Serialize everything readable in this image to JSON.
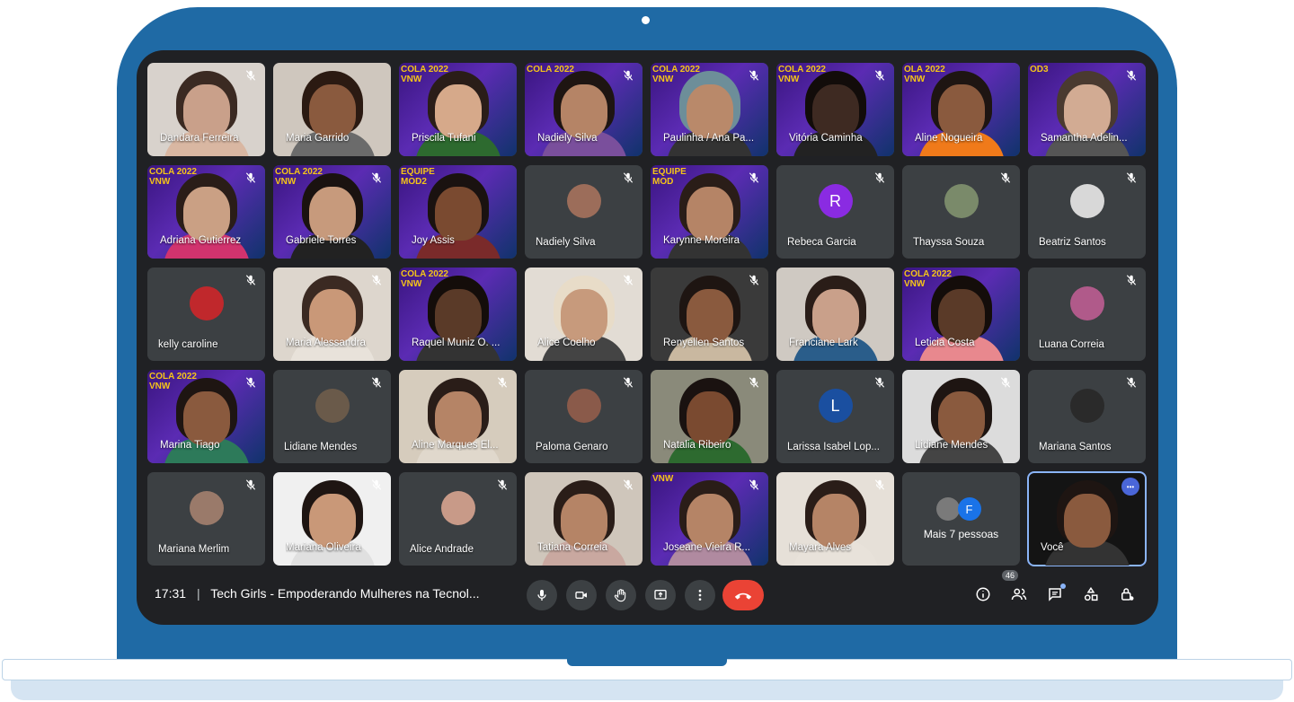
{
  "colors": {
    "laptop": "#1f6aa5",
    "screen_bg": "#202124",
    "tile_bg": "#3c4043",
    "hangup": "#ea4335",
    "self_outline": "#8ab4f8"
  },
  "tiles": [
    {
      "name": "Dandara Ferreira",
      "kind": "video",
      "muted": true,
      "skin": "#c9a08a",
      "hair": "#3b2a22",
      "shirt": "#d9b7a2",
      "bg": "#d8d2cc"
    },
    {
      "name": "Maria Garrido",
      "kind": "video",
      "muted": false,
      "skin": "#8a5a3e",
      "hair": "#2b1a12",
      "shirt": "#6b6b6b",
      "bg": "#cfc7be"
    },
    {
      "name": "Priscila Tufani",
      "kind": "video",
      "muted": false,
      "banner": true,
      "banner_text": "COLA 2022\nVNW",
      "skin": "#d6a98a",
      "hair": "#2a1d18",
      "shirt": "#2d6a2f",
      "bg": ""
    },
    {
      "name": "Nadiely Silva",
      "kind": "video",
      "muted": true,
      "banner": true,
      "banner_text": "COLA 2022",
      "skin": "#b58466",
      "hair": "#1e1512",
      "shirt": "#7a4f9c",
      "bg": ""
    },
    {
      "name": "Paulinha / Ana Pa...",
      "kind": "video",
      "muted": true,
      "banner": true,
      "banner_text": "COLA 2022\nVNW",
      "skin": "#b9896a",
      "hair": "#6d8e99",
      "shirt": "#333333",
      "bg": ""
    },
    {
      "name": "Vitória Caminha",
      "kind": "video",
      "muted": true,
      "banner": true,
      "banner_text": "COLA 2022\nVNW",
      "skin": "#3e2a22",
      "hair": "#120c0a",
      "shirt": "#222222",
      "bg": ""
    },
    {
      "name": "Aline Nogueira",
      "kind": "video",
      "muted": false,
      "banner": true,
      "banner_text": "OLA 2022\nVNW",
      "skin": "#8a5a3e",
      "hair": "#1e1512",
      "shirt": "#f07a1a",
      "bg": ""
    },
    {
      "name": "Samantha Adelin...",
      "kind": "video",
      "muted": true,
      "banner": true,
      "banner_text": "OD3",
      "skin": "#d2ab93",
      "hair": "#4a3a30",
      "shirt": "#555555",
      "bg": ""
    },
    {
      "name": "Adriana Gutierrez",
      "kind": "video",
      "muted": true,
      "banner": true,
      "banner_text": "COLA 2022\nVNW",
      "skin": "#caa084",
      "hair": "#2a1d18",
      "shirt": "#d1336e",
      "bg": ""
    },
    {
      "name": "Gabriele Torres",
      "kind": "video",
      "muted": true,
      "banner": true,
      "banner_text": "COLA 2022\nVNW",
      "skin": "#c79a7c",
      "hair": "#1a1210",
      "shirt": "#222222",
      "bg": ""
    },
    {
      "name": "Joy Assis",
      "kind": "video",
      "muted": false,
      "banner": true,
      "banner_text": "EQUIPE\nMOD2",
      "skin": "#7a4a30",
      "hair": "#1a1210",
      "shirt": "#7a2a2a",
      "bg": ""
    },
    {
      "name": "Nadiely Silva",
      "kind": "avatar",
      "muted": true,
      "avatar_color": "#9c6d5a"
    },
    {
      "name": "Karynne Moreira",
      "kind": "video",
      "muted": true,
      "banner": true,
      "banner_text": "EQUIPE\nMOD",
      "skin": "#b58466",
      "hair": "#2a1d18",
      "shirt": "#333333",
      "bg": ""
    },
    {
      "name": "Rebeca Garcia",
      "kind": "letter",
      "muted": true,
      "letter": "R",
      "avatar_color": "#8a2be2"
    },
    {
      "name": "Thayssa Souza",
      "kind": "avatar",
      "muted": true,
      "avatar_color": "#7a8a6a"
    },
    {
      "name": "Beatriz Santos",
      "kind": "avatar",
      "muted": true,
      "avatar_color": "#d8d8d8"
    },
    {
      "name": "kelly caroline",
      "kind": "avatar",
      "muted": true,
      "avatar_color": "#c0282c"
    },
    {
      "name": "Maria Alessandra",
      "kind": "video",
      "muted": true,
      "skin": "#c99878",
      "hair": "#3b2a22",
      "shirt": "#e8e2da",
      "bg": "#ddd6cd"
    },
    {
      "name": "Raquel Muniz O. ...",
      "kind": "video",
      "muted": false,
      "banner": true,
      "banner_text": "COLA 2022\nVNW",
      "skin": "#5a3a28",
      "hair": "#140d0a",
      "shirt": "#333333",
      "bg": ""
    },
    {
      "name": "Alice Coelho",
      "kind": "video",
      "muted": true,
      "skin": "#c79a7c",
      "hair": "#e8dcc8",
      "shirt": "#444444",
      "bg": "#e2dcd4"
    },
    {
      "name": "Renyellen Santos",
      "kind": "video",
      "muted": true,
      "skin": "#8a5a3e",
      "hair": "#1e1512",
      "shirt": "#c9b8a0",
      "bg": "#3a3a3a"
    },
    {
      "name": "Franciane Lark",
      "kind": "video",
      "muted": false,
      "skin": "#c9a08a",
      "hair": "#2a1d18",
      "shirt": "#2a5d8a",
      "bg": "#cfc9c2"
    },
    {
      "name": "Leticia Costa",
      "kind": "video",
      "muted": false,
      "banner": true,
      "banner_text": "COLA 2022\nVNW",
      "skin": "#5a3a28",
      "hair": "#140d0a",
      "shirt": "#e8888e",
      "bg": ""
    },
    {
      "name": "Luana Correia",
      "kind": "avatar",
      "muted": true,
      "avatar_color": "#b05a8a"
    },
    {
      "name": "Marina Tiago",
      "kind": "video",
      "muted": true,
      "banner": true,
      "banner_text": "COLA 2022\nVNW",
      "skin": "#8a5a3e",
      "hair": "#1e1512",
      "shirt": "#2d7a5a",
      "bg": ""
    },
    {
      "name": "Lidiane Mendes",
      "kind": "avatar",
      "muted": true,
      "avatar_color": "#6a5a4a"
    },
    {
      "name": "Aline Marques El...",
      "kind": "video",
      "muted": true,
      "skin": "#b58466",
      "hair": "#2a1d18",
      "shirt": "#e0d8cc",
      "bg": "#d6ccbd"
    },
    {
      "name": "Paloma Genaro",
      "kind": "avatar",
      "muted": true,
      "avatar_color": "#8a5a4a"
    },
    {
      "name": "Natalia Ribeiro",
      "kind": "video",
      "muted": true,
      "skin": "#7a4a30",
      "hair": "#1a1210",
      "shirt": "#2d6a2f",
      "bg": "#8a8a7a"
    },
    {
      "name": "Larissa Isabel Lop...",
      "kind": "letter",
      "muted": true,
      "letter": "L",
      "avatar_color": "#1a4fa0"
    },
    {
      "name": "Lidiane Mendes",
      "kind": "video",
      "muted": true,
      "skin": "#8a5a3e",
      "hair": "#1e1512",
      "shirt": "#444444",
      "bg": "#dcdcdc"
    },
    {
      "name": "Mariana Santos",
      "kind": "avatar",
      "muted": true,
      "avatar_color": "#2a2a2a"
    },
    {
      "name": "Mariana Merlim",
      "kind": "avatar",
      "muted": true,
      "avatar_color": "#9a7a6a"
    },
    {
      "name": "Mariana Oliveira",
      "kind": "video",
      "muted": true,
      "skin": "#c99878",
      "hair": "#1e1512",
      "shirt": "#e0e0e0",
      "bg": "#f0f0f0"
    },
    {
      "name": "Alice Andrade",
      "kind": "avatar",
      "muted": true,
      "avatar_color": "#c89a88"
    },
    {
      "name": "Tatiana Correia",
      "kind": "video",
      "muted": true,
      "skin": "#b58466",
      "hair": "#2a1d18",
      "shirt": "#c9a8a0",
      "bg": "#cfc6bb"
    },
    {
      "name": "Joseane Vieira R...",
      "kind": "video",
      "muted": true,
      "banner": true,
      "banner_text": "VNW",
      "skin": "#b58466",
      "hair": "#2a1d18",
      "shirt": "#b08aa0",
      "bg": ""
    },
    {
      "name": "Mayara Alves",
      "kind": "video",
      "muted": true,
      "skin": "#b58466",
      "hair": "#2a1d18",
      "shirt": "#e8e2da",
      "bg": "#e6e0d8"
    },
    {
      "name": "Mais 7 pessoas",
      "kind": "more",
      "muted": false,
      "letter": "F",
      "avatar_color": "#1a73e8"
    },
    {
      "name": "Você",
      "kind": "self",
      "muted": false,
      "skin": "#8a5a3e",
      "hair": "#1e1512",
      "shirt": "#333333",
      "bg": "#141414"
    }
  ],
  "bottom_bar": {
    "time": "17:31",
    "separator": "|",
    "meeting_title": "Tech Girls - Empoderando Mulheres na Tecnol...",
    "participant_count": "46"
  },
  "icons": {
    "mic": "microphone-icon",
    "camera": "camera-icon",
    "hand": "raise-hand-icon",
    "present": "present-screen-icon",
    "more": "more-options-icon",
    "hangup": "hangup-icon",
    "info": "info-icon",
    "people": "people-icon",
    "chat": "chat-icon",
    "activities": "activities-icon",
    "host": "host-controls-icon"
  }
}
